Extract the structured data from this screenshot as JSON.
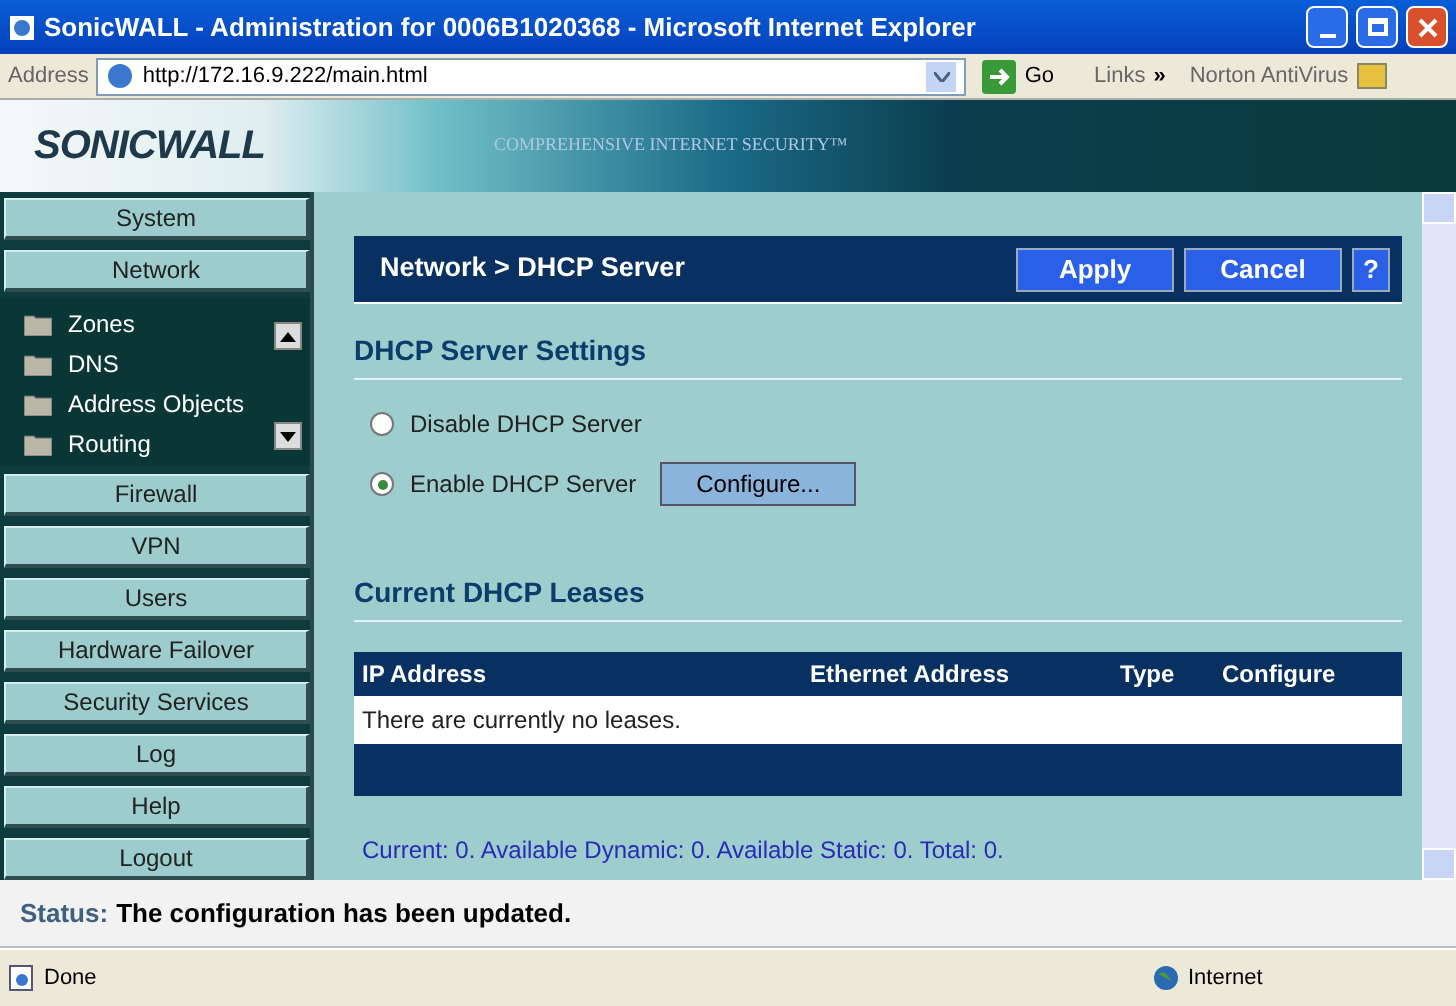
{
  "window": {
    "title": "SonicWALL - Administration for 0006B1020368 - Microsoft Internet Explorer"
  },
  "address_bar": {
    "label": "Address",
    "url": "http://172.16.9.222/main.html",
    "go": "Go",
    "links": "Links",
    "chevron": "»",
    "toolbar": "Norton AntiVirus"
  },
  "banner": {
    "logo": "SONICWALL",
    "tagline": "COMPREHENSIVE INTERNET SECURITY™"
  },
  "sidebar": {
    "items": [
      {
        "label": "System"
      },
      {
        "label": "Network",
        "expanded": true,
        "children": [
          {
            "label": "Zones"
          },
          {
            "label": "DNS"
          },
          {
            "label": "Address Objects"
          },
          {
            "label": "Routing"
          }
        ]
      },
      {
        "label": "Firewall"
      },
      {
        "label": "VPN"
      },
      {
        "label": "Users"
      },
      {
        "label": "Hardware Failover"
      },
      {
        "label": "Security Services"
      },
      {
        "label": "Log"
      },
      {
        "label": "Help"
      },
      {
        "label": "Logout"
      }
    ]
  },
  "header": {
    "title": "Network > DHCP Server",
    "buttons": [
      "Apply",
      "Cancel",
      "?"
    ]
  },
  "settings": {
    "title": "DHCP Server Settings",
    "options": [
      {
        "label": "Disable DHCP Server",
        "selected": false
      },
      {
        "label": "Enable DHCP Server",
        "selected": true,
        "button": "Configure..."
      }
    ]
  },
  "leases": {
    "title": "Current DHCP Leases",
    "columns": [
      "IP Address",
      "Ethernet Address",
      "Type",
      "Configure"
    ],
    "empty": "There are currently no leases.",
    "summary": "Current: 0. Available Dynamic: 0. Available Static: 0. Total: 0."
  },
  "status": {
    "label": "Status:",
    "message": "The configuration has been updated."
  },
  "status_bar": {
    "text": "Done",
    "zone": "Internet"
  }
}
